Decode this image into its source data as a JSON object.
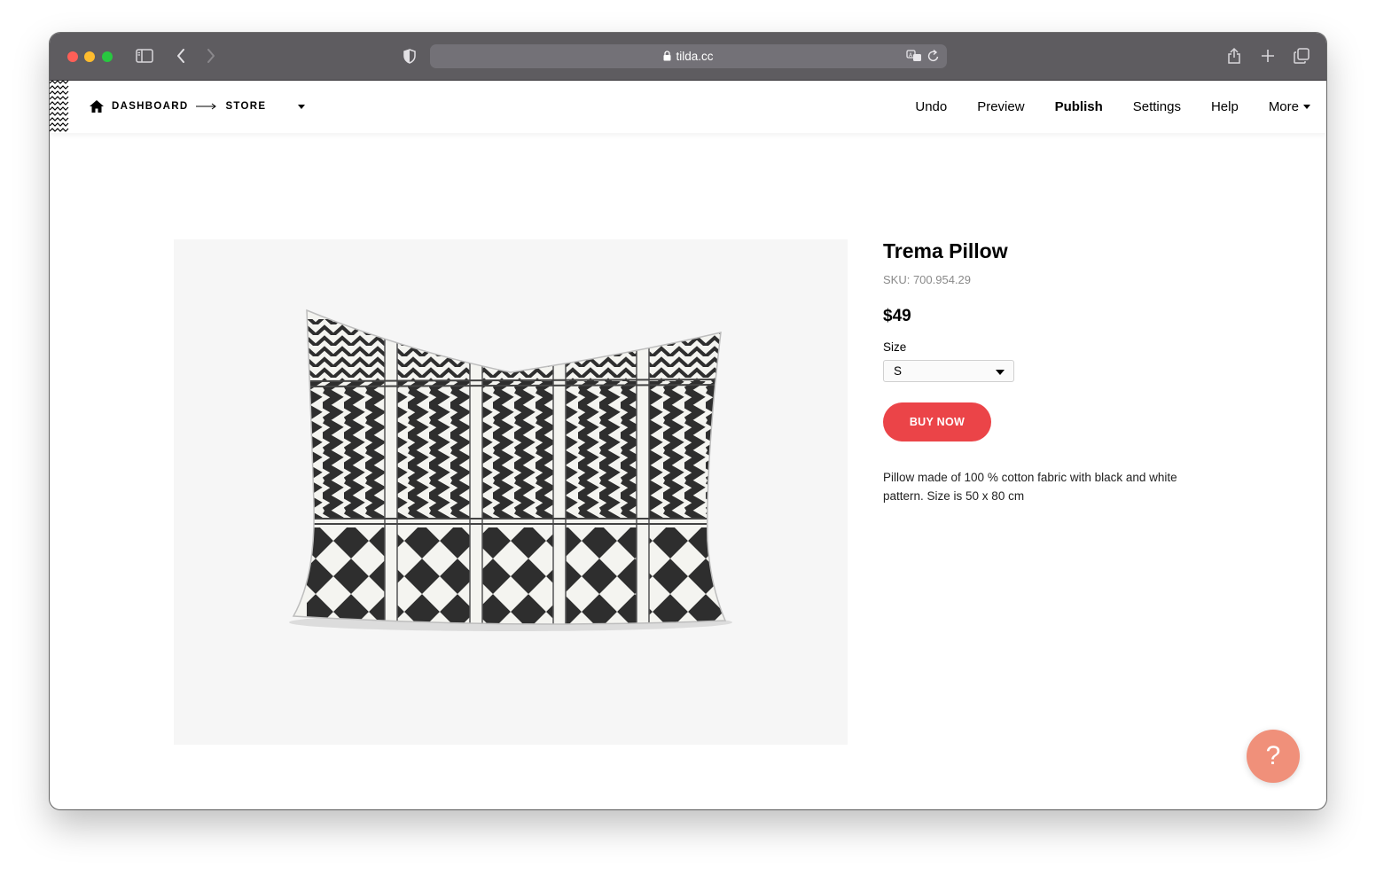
{
  "browser": {
    "url": "tilda.cc",
    "icons": [
      "sidebar-icon",
      "back-icon",
      "forward-icon",
      "shield-icon",
      "translate-icon",
      "reload-icon",
      "share-icon",
      "new-tab-icon",
      "tabs-overview-icon"
    ]
  },
  "header": {
    "breadcrumbs": [
      "DASHBOARD",
      "STORE"
    ],
    "menu": {
      "undo": "Undo",
      "preview": "Preview",
      "publish": "Publish",
      "settings": "Settings",
      "help": "Help",
      "more": "More"
    }
  },
  "product": {
    "title": "Trema Pillow",
    "sku": "SKU: 700.954.29",
    "price": "$49",
    "size_label": "Size",
    "size_value": "S",
    "buy_label": "BUY NOW",
    "description": "Pillow made of 100 % cotton fabric with black and white pattern. Size is 50 x 80 cm"
  },
  "help_button": {
    "label": "?"
  },
  "colors": {
    "accent": "#eb4448",
    "help": "#f0907a",
    "toolbar": "#5e5c60"
  }
}
